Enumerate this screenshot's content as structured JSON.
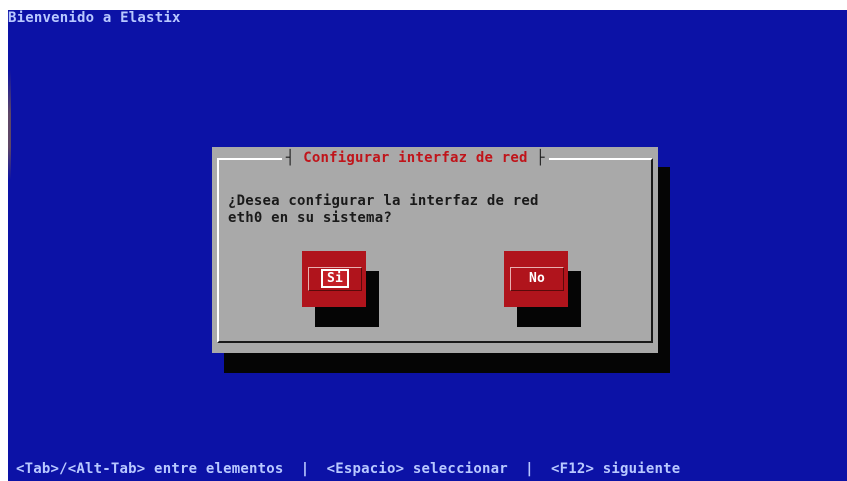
{
  "window": {
    "title": "Bienvenido a Elastix"
  },
  "dialog": {
    "title": "Configurar interfaz de red",
    "message_line1": "¿Desea configurar la interfaz de red",
    "message_line2": "eth0 en su sistema?",
    "buttons": {
      "yes_label": "Si",
      "no_label": "No"
    }
  },
  "status_bar": {
    "text": "<Tab>/<Alt-Tab> entre elementos  |  <Espacio> seleccionar  |  <F12> siguiente"
  },
  "colors": {
    "background": "#0c12a6",
    "dialog": "#a9a9a9",
    "title_text": "#c0141a",
    "button": "#b0141c"
  }
}
